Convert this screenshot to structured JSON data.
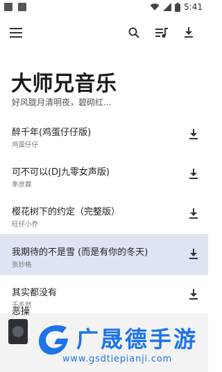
{
  "status_bar": {
    "time": "5:41",
    "icons": [
      "wifi-icon",
      "signal-icon",
      "battery-icon"
    ]
  },
  "toolbar": {
    "menu_icon": "menu-icon",
    "search_icon": "search-icon",
    "queue_icon": "playlist-music-icon",
    "download_icon": "download-icon"
  },
  "header": {
    "title": "大师兄音乐",
    "subtitle": "好风胧月清明夜，碧砌红..."
  },
  "songs": [
    {
      "title": "醉千年(鸡蛋仔仔版)",
      "artist": "鸡蛋仔仔"
    },
    {
      "title": "可不可以(DJ九零女声版)",
      "artist": "季彦霖"
    },
    {
      "title": "樱花树下的约定（完整版）",
      "artist": "旺仔小乔"
    },
    {
      "title": "我期待的不是雪 (而是有你的冬天)",
      "artist": "张妙格"
    },
    {
      "title": "其实都没有",
      "artist": "于冬然"
    }
  ],
  "active_index": 3,
  "player": {
    "peek_title": "恶操"
  },
  "watermark": {
    "name": "广晟德手游",
    "url": "www.gsdtiepianji.com"
  },
  "colors": {
    "accent": "#1e73e8",
    "active_row": "#dfe4f5",
    "icon": "#333333"
  }
}
